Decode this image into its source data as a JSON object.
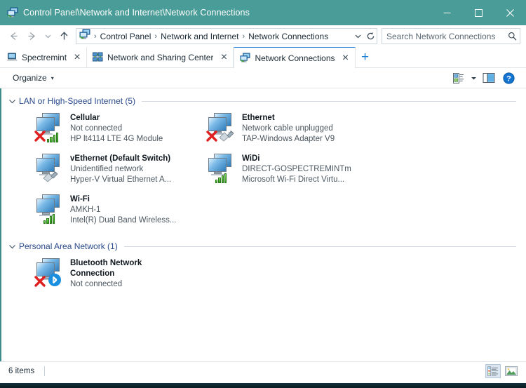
{
  "window": {
    "title": "Control Panel\\Network and Internet\\Network Connections",
    "title_icon": "network-connections-icon",
    "minimize_label": "Minimize",
    "maximize_label": "Maximize",
    "close_label": "Close",
    "accent_color": "#4a9c98"
  },
  "address_bar": {
    "back_label": "Back",
    "forward_label": "Forward",
    "recent_label": "Recent locations",
    "up_label": "Up one level",
    "crumbs": [
      "Control Panel",
      "Network and Internet",
      "Network Connections"
    ],
    "separator": "›",
    "dropdown_label": "Previous locations",
    "refresh_label": "Refresh"
  },
  "search": {
    "placeholder": "Search Network Connections",
    "value": "",
    "icon": "search-icon"
  },
  "tabs": [
    {
      "label": "Spectremint",
      "icon": "computer-icon",
      "active": false,
      "close_label": "×"
    },
    {
      "label": "Network and Sharing Center",
      "icon": "network-sharing-icon",
      "active": false,
      "close_label": "×"
    },
    {
      "label": "Network Connections",
      "icon": "network-connections-icon",
      "active": true,
      "close_label": "×"
    }
  ],
  "new_tab_label": "+",
  "command_bar": {
    "organize_label": "Organize",
    "organize_caret": "▾",
    "view_options_label": "Change your view",
    "view_caret": "▾",
    "preview_pane_label": "Show the preview pane",
    "help_label": "Help"
  },
  "groups": [
    {
      "title": "LAN or High-Speed Internet (5)",
      "chevron": "⌄",
      "items": [
        {
          "name": "Cellular",
          "status": "Not connected",
          "device": "HP lt4114 LTE 4G Module",
          "icon": "computer-icon",
          "badges": [
            "red-x-icon",
            "signal-bars-icon"
          ],
          "wrap": false
        },
        {
          "name": "Ethernet",
          "status": "Network cable unplugged",
          "device": "TAP-Windows Adapter V9",
          "icon": "computer-icon",
          "badges": [
            "red-x-icon",
            "network-cable-icon"
          ],
          "wrap": false
        },
        {
          "name": "vEthernet (Default Switch)",
          "status": "Unidentified network",
          "device": "Hyper-V Virtual Ethernet A...",
          "icon": "computer-icon",
          "badges": [
            "network-cable-icon"
          ],
          "wrap": false
        },
        {
          "name": "WiDi",
          "status": "DIRECT-GOSPECTREMINTm",
          "device": "Microsoft Wi-Fi Direct Virtu...",
          "icon": "computer-icon",
          "badges": [
            "signal-bars-icon"
          ],
          "wrap": false
        },
        {
          "name": "Wi-Fi",
          "status": "AMKH-1",
          "device": "Intel(R) Dual Band Wireless...",
          "icon": "computer-icon",
          "badges": [
            "signal-bars-icon"
          ],
          "wrap": false
        }
      ]
    },
    {
      "title": "Personal Area Network (1)",
      "chevron": "⌄",
      "items": [
        {
          "name": "Bluetooth Network Connection",
          "status": "Not connected",
          "device": "",
          "icon": "computer-icon",
          "badges": [
            "red-x-icon",
            "bluetooth-icon"
          ],
          "wrap": true
        }
      ]
    }
  ],
  "status_bar": {
    "item_count": "6 items",
    "details_view_label": "Details view",
    "large_icons_view_label": "Large icons view"
  }
}
